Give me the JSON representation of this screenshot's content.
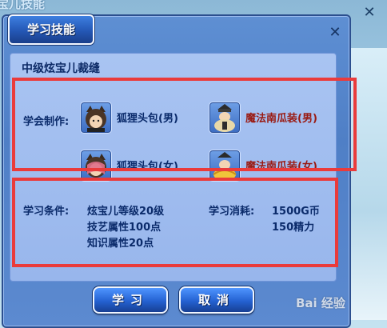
{
  "background_window": {
    "title": "宝儿技能"
  },
  "dialog": {
    "title": "学习技能",
    "skill_name": "中级炫宝儿裁缝",
    "craft_label": "学会制作:",
    "items": [
      {
        "name": "狐狸头包(男)",
        "icon": "fox-hood-male-icon"
      },
      {
        "name": "魔法南瓜装(男)",
        "icon": "pumpkin-costume-male-icon"
      },
      {
        "name": "狐狸头包(女)",
        "icon": "fox-hood-female-icon"
      },
      {
        "name": "魔法南瓜装(女)",
        "icon": "pumpkin-costume-female-icon"
      }
    ],
    "conditions_label": "学习条件:",
    "conditions": [
      "炫宝儿等级20级",
      "技艺属性100点",
      "知识属性20点"
    ],
    "cost_label": "学习消耗:",
    "costs": [
      "1500G币",
      "150精力"
    ],
    "learn_button": "学习",
    "cancel_button": "取消"
  },
  "watermark": "Bai 经验",
  "colors": {
    "highlight": "#ea3b3b",
    "dialog_blue": "#4f7fc6",
    "button_blue": "#2461d1"
  }
}
